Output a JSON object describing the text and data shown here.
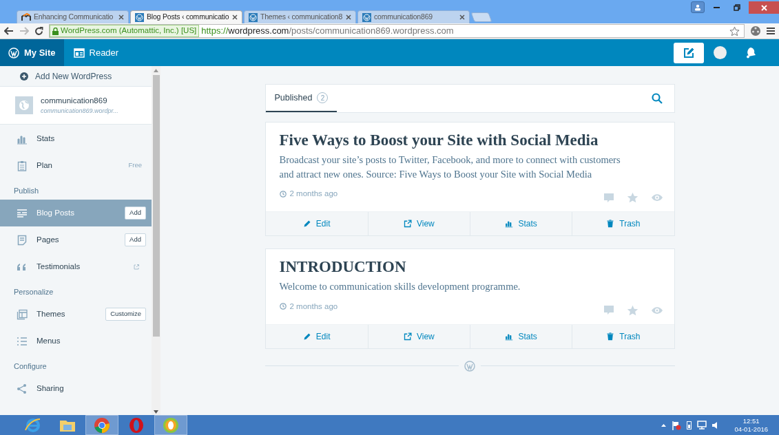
{
  "browser": {
    "tabs": [
      {
        "label": "Enhancing Communicatio",
        "selected": false,
        "kind": "moodle"
      },
      {
        "label": "Blog Posts ‹ communicatio",
        "selected": true,
        "kind": "wp"
      },
      {
        "label": "Themes ‹ communication8",
        "selected": false,
        "kind": "wp"
      },
      {
        "label": "communication869",
        "selected": false,
        "kind": "wp"
      }
    ],
    "security_label": "WordPress.com (Automattic, Inc.) [US]",
    "url_scheme": "https://",
    "url_host": "wordpress.com",
    "url_path": "/posts/communication869.wordpress.com"
  },
  "masthead": {
    "my_site": "My Site",
    "reader": "Reader"
  },
  "sidebar": {
    "add_new": "Add New WordPress",
    "site": {
      "name": "communication869",
      "url": "communication869.wordpr..."
    },
    "items": [
      {
        "kind": "stats",
        "label": "Stats",
        "selected": false
      },
      {
        "kind": "plan",
        "label": "Plan",
        "note": "Free",
        "selected": false
      },
      {
        "kind": "section",
        "label": "Publish"
      },
      {
        "kind": "posts",
        "label": "Blog Posts",
        "button": "Add",
        "selected": true
      },
      {
        "kind": "pages",
        "label": "Pages",
        "button": "Add",
        "selected": false
      },
      {
        "kind": "quote",
        "label": "Testimonials",
        "external": true,
        "selected": false
      },
      {
        "kind": "section",
        "label": "Personalize"
      },
      {
        "kind": "themes",
        "label": "Themes",
        "button": "Customize",
        "selected": false
      },
      {
        "kind": "menus",
        "label": "Menus",
        "selected": false
      },
      {
        "kind": "section",
        "label": "Configure"
      },
      {
        "kind": "share",
        "label": "Sharing",
        "selected": false
      }
    ]
  },
  "filter": {
    "label": "Published",
    "count": "2",
    "selected": true
  },
  "posts": [
    {
      "title": "Five Ways to Boost your Site with Social Media",
      "excerpt": "Broadcast your site’s posts to Twitter, Facebook, and more to connect with customers and attract new ones. Source: Five Ways to Boost your Site with Social Media",
      "time": "2 months ago",
      "actions": [
        {
          "kind": "edit",
          "label": "Edit"
        },
        {
          "kind": "view",
          "label": "View"
        },
        {
          "kind": "stats",
          "label": "Stats"
        },
        {
          "kind": "trash",
          "label": "Trash"
        }
      ]
    },
    {
      "title": "INTRODUCTION",
      "excerpt": "Welcome to communication skills development programme.",
      "time": "2 months ago",
      "actions": [
        {
          "kind": "edit",
          "label": "Edit"
        },
        {
          "kind": "view",
          "label": "View"
        },
        {
          "kind": "stats",
          "label": "Stats"
        },
        {
          "kind": "trash",
          "label": "Trash"
        }
      ]
    }
  ],
  "taskbar": {
    "apps": [
      {
        "kind": "ie",
        "selected": false
      },
      {
        "kind": "folder",
        "selected": false
      },
      {
        "kind": "chrome",
        "selected": true
      },
      {
        "kind": "opera",
        "selected": false
      },
      {
        "kind": "other",
        "selected": true
      }
    ],
    "time": "12:51",
    "date": "04-01-2016"
  }
}
